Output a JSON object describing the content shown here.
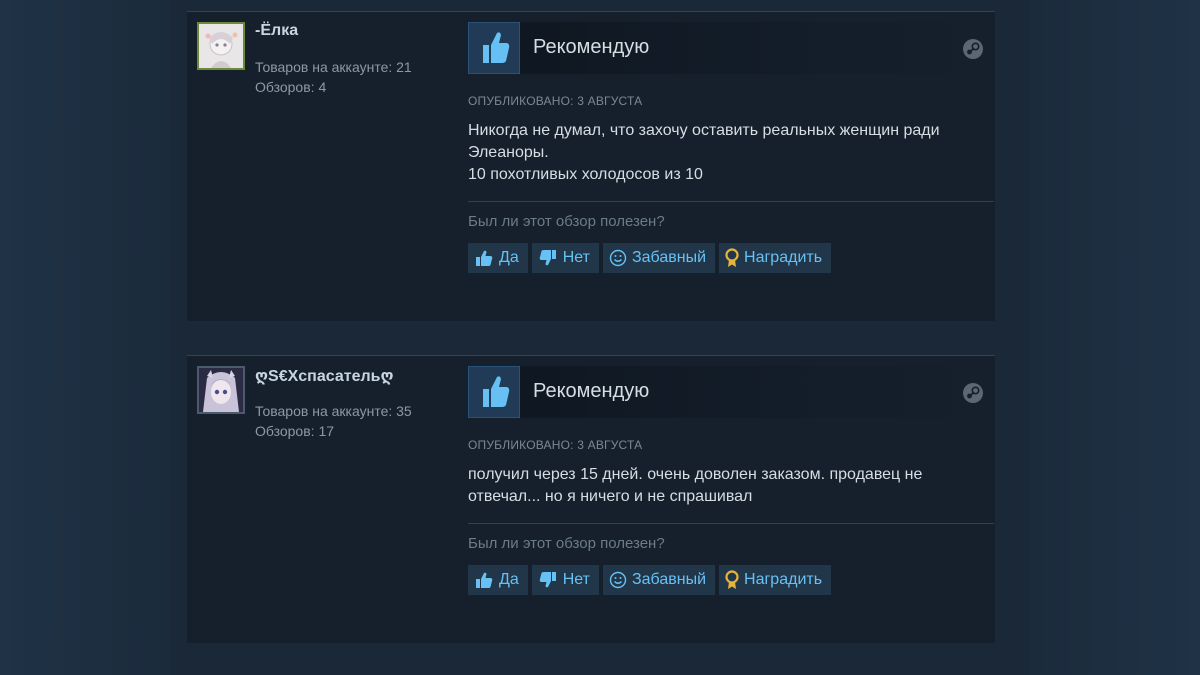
{
  "reviews": [
    {
      "author": {
        "name": "-Ёлка",
        "products_line": "Товаров на аккаунте: 21",
        "reviews_line": "Обзоров: 4"
      },
      "recommendation": "Рекомендую",
      "posted": "ОПУБЛИКОВАНО: 3 АВГУСТА",
      "text": "Никогда не думал, что захочу оставить реальных женщин ради\nЭлеаноры.\n10 похотливых холодосов из 10",
      "helpful_question": "Был ли этот обзор полезен?",
      "buttons": {
        "yes": "Да",
        "no": "Нет",
        "funny": "Забавный",
        "award": "Наградить"
      }
    },
    {
      "author": {
        "name": "ღS€Xспасательღ",
        "products_line": "Товаров на аккаунте: 35",
        "reviews_line": "Обзоров: 17"
      },
      "recommendation": "Рекомендую",
      "posted": "ОПУБЛИКОВАНО: 3 АВГУСТА",
      "text": "получил через 15 дней. очень доволен заказом. продавец не\nотвечал... но я ничего и не спрашивал",
      "helpful_question": "Был ли этот обзор полезен?",
      "buttons": {
        "yes": "Да",
        "no": "Нет",
        "funny": "Забавный",
        "award": "Наградить"
      }
    }
  ],
  "icons": {
    "thumb_up": "thumbs-up-icon",
    "thumb_down": "thumbs-down-icon",
    "funny": "smiley-icon",
    "award": "award-ribbon-icon",
    "platform": "steam-logo-icon"
  },
  "colors": {
    "background": "#1b2838",
    "card": "#16202d",
    "link_blue": "#67c1f5",
    "button_bg": "#213649",
    "award_gold": "#e8b33a"
  }
}
